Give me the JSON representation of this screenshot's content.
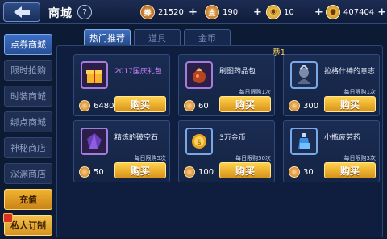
{
  "header": {
    "title": "商城",
    "help_label": "?",
    "currencies": [
      {
        "icon": "coin-bag-icon",
        "value": "21520"
      },
      {
        "icon": "diamond-bag-icon",
        "value": "190"
      },
      {
        "icon": "gold-ticket-icon",
        "value": "10"
      },
      {
        "icon": "gold-coin-icon",
        "value": "407404"
      }
    ],
    "plus_label": "+"
  },
  "sidebar": {
    "items": [
      {
        "label": "点券商城"
      },
      {
        "label": "限时抢购"
      },
      {
        "label": "时装商城"
      },
      {
        "label": "绑点商城"
      },
      {
        "label": "神秘商店"
      },
      {
        "label": "深渊商店"
      },
      {
        "label": "充值"
      },
      {
        "label": "私人订制"
      }
    ]
  },
  "tabs": [
    {
      "label": "热门推荐"
    },
    {
      "label": "道具"
    },
    {
      "label": "金币"
    }
  ],
  "panel_tag": "恭1",
  "items": [
    {
      "name": "2017国庆礼包",
      "price": "6480",
      "limit": "",
      "buy_label": "购买",
      "icon": "gift-box-icon"
    },
    {
      "name": "刷图药品包",
      "price": "60",
      "limit": "每日限购1次",
      "buy_label": "购买",
      "icon": "potion-bag-icon"
    },
    {
      "name": "拉格什神的意志",
      "price": "300",
      "limit": "每日限购1次",
      "buy_label": "购买",
      "icon": "god-will-icon"
    },
    {
      "name": "精炼的破空石",
      "price": "50",
      "limit": "每日限购5次",
      "buy_label": "购买",
      "icon": "void-stone-icon"
    },
    {
      "name": "3万金币",
      "price": "100",
      "limit": "每日限购50次",
      "buy_label": "购买",
      "icon": "gold-coin-pile-icon"
    },
    {
      "name": "小瓶疲劳药",
      "price": "30",
      "limit": "每日限购3次",
      "buy_label": "购买",
      "icon": "fatigue-potion-icon"
    }
  ]
}
